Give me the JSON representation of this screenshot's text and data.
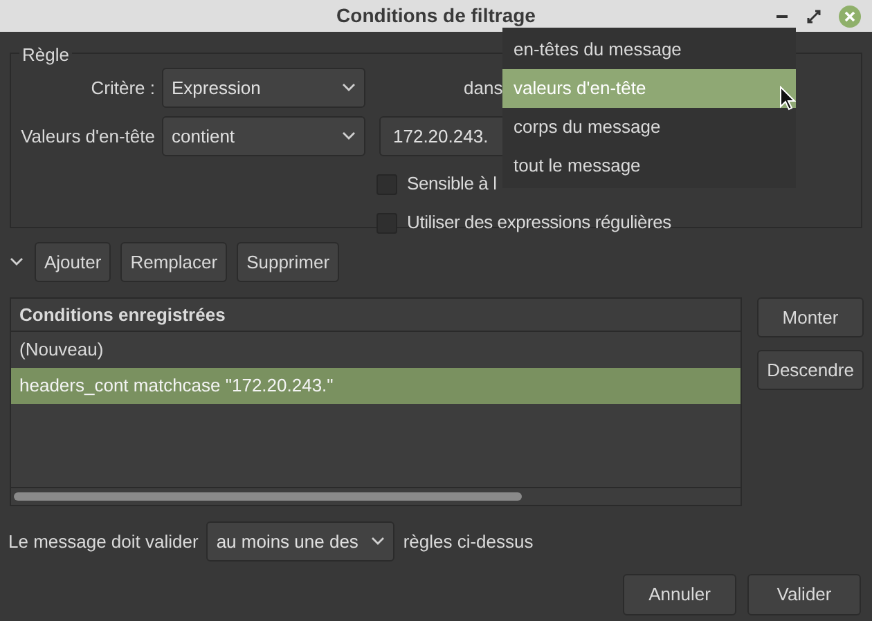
{
  "window": {
    "title": "Conditions de filtrage"
  },
  "rule": {
    "legend": "Règle",
    "criterion_label": "Critère :",
    "criterion_value": "Expression",
    "in_label": "dans",
    "header_label": "Valeurs d'en-tête",
    "operator_value": "contient",
    "expression_value": "172.20.243.",
    "checkboxes": [
      {
        "label": "Sensible à l",
        "checked": false
      },
      {
        "label": "Utiliser des expressions régulières",
        "checked": false
      }
    ]
  },
  "dropdown_menu": {
    "items": [
      {
        "label": "en-têtes du message",
        "selected": false
      },
      {
        "label": "valeurs d'en-tête",
        "selected": true
      },
      {
        "label": "corps du message",
        "selected": false
      },
      {
        "label": "tout le message",
        "selected": false
      }
    ]
  },
  "toolbar": {
    "buttons": [
      "Ajouter",
      "Remplacer",
      "Supprimer"
    ]
  },
  "conditions": {
    "header": "Conditions enregistrées",
    "rows": [
      {
        "text": "(Nouveau)",
        "selected": false
      },
      {
        "text": "headers_cont matchcase \"172.20.243.\"",
        "selected": true
      }
    ]
  },
  "side_buttons": [
    "Monter",
    "Descendre"
  ],
  "match": {
    "prefix": "Le message doit valider",
    "value": "au moins une des",
    "suffix": "règles ci-dessus"
  },
  "buttons": [
    "Annuler",
    "Valider"
  ]
}
